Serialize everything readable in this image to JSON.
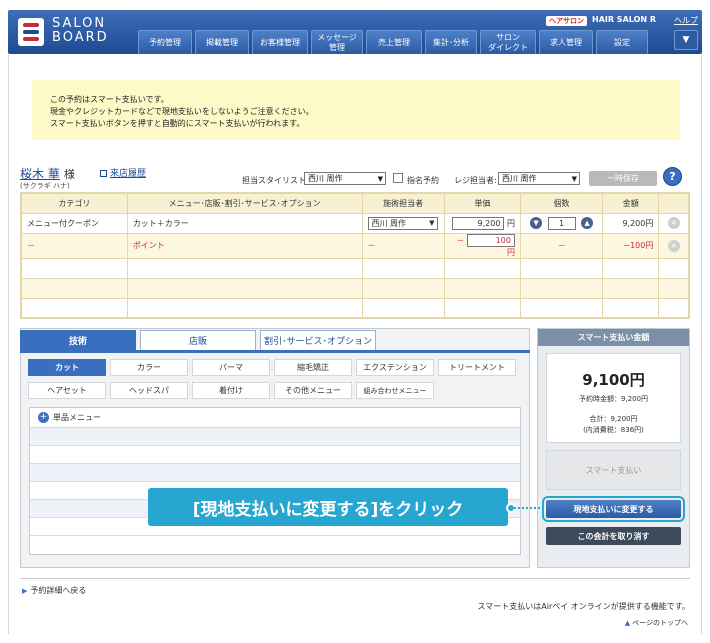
{
  "header": {
    "logo_line1": "SALON",
    "logo_line2": "BOARD",
    "badge": "ヘアサロン",
    "salon_name": "HAIR SALON R",
    "help": "ヘルプ",
    "nav": [
      {
        "label": "予約管理"
      },
      {
        "label": "掲載管理"
      },
      {
        "label": "お客様管理"
      },
      {
        "label": "メッセージ\n管理"
      },
      {
        "label": "売上管理"
      },
      {
        "label": "集計･分析"
      },
      {
        "label": "サロン\nダイレクト"
      },
      {
        "label": "求人管理"
      },
      {
        "label": "設定"
      }
    ],
    "menu_icon": "triangle-down-icon"
  },
  "notice": {
    "line1": "この予約はスマート支払いです。",
    "line2": "現金やクレジットカードなどで現地支払いをしないようご注意ください。",
    "line3": "スマート支払いボタンを押すと自動的にスマート支払いが行われます。"
  },
  "customer": {
    "name": "桜木 華",
    "honorific": "様",
    "kana": "(サクラギ ハナ)",
    "visit_history": "来店履歴",
    "stylist_label": "担当スタイリスト:",
    "stylist_value": "西川 周作",
    "nominated_label": "指名予約",
    "register_label": "レジ担当者:",
    "register_value": "西川 周作",
    "temp_save": "一時保存",
    "help_mark": "?"
  },
  "table": {
    "headers": [
      "カテゴリ",
      "メニュー･店販･割引･サービス･オプション",
      "施術担当者",
      "単価",
      "個数",
      "金額"
    ],
    "rows": [
      {
        "category": "メニュー付クーポン",
        "menu": "カット＋カラー",
        "staff": "西川 周作",
        "price": "9,200",
        "unit": "円",
        "qty": "1",
        "amount": "9,200円"
      },
      {
        "category": "－",
        "menu": "ポイント",
        "staff": "－",
        "price_sign": "－",
        "price": "100",
        "unit": "円",
        "qty": "－",
        "amount": "−100円"
      }
    ],
    "decrease": "▼",
    "increase": "▲",
    "delete": "×"
  },
  "tabs": [
    {
      "label": "技術",
      "active": true
    },
    {
      "label": "店販",
      "active": false
    },
    {
      "label": "割引･サービス･オプション",
      "active": false
    }
  ],
  "categories": [
    {
      "label": "カット",
      "active": true
    },
    {
      "label": "カラー"
    },
    {
      "label": "パーマ"
    },
    {
      "label": "縮毛矯正"
    },
    {
      "label": "エクステンション"
    },
    {
      "label": "トリートメント"
    },
    {
      "label": "ヘアセット"
    },
    {
      "label": "ヘッドスパ"
    },
    {
      "label": "着付け"
    },
    {
      "label": "その他メニュー"
    },
    {
      "label": "組み合わせメニュー"
    }
  ],
  "menu_list": {
    "first_item": "単品メニュー"
  },
  "smart_pay": {
    "title": "スマート支払い金額",
    "amount": "9,100円",
    "scheduled": "予約時金額：9,200円",
    "total": "合計：9,200円",
    "tax": "(内消費税：836円)",
    "smart_button": "スマート支払い",
    "change_button": "現地支払いに変更する",
    "cancel_button": "この会計を取り消す"
  },
  "callout": {
    "text": "[現地支払いに変更する]をクリック"
  },
  "footer": {
    "back": "予約詳細へ戻る",
    "note": "スマート支払いはAirペイ オンラインが提供する機能です。",
    "page_top": "ページのトップへ"
  }
}
